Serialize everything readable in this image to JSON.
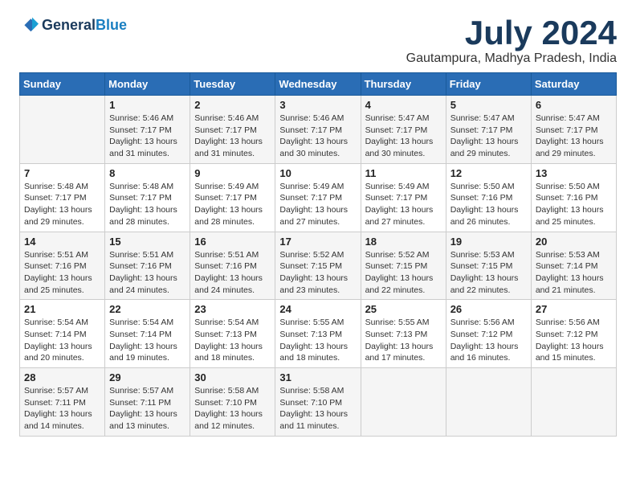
{
  "logo": {
    "line1": "General",
    "line2": "Blue"
  },
  "title": "July 2024",
  "location": "Gautampura, Madhya Pradesh, India",
  "weekdays": [
    "Sunday",
    "Monday",
    "Tuesday",
    "Wednesday",
    "Thursday",
    "Friday",
    "Saturday"
  ],
  "weeks": [
    [
      {
        "day": "",
        "info": ""
      },
      {
        "day": "1",
        "info": "Sunrise: 5:46 AM\nSunset: 7:17 PM\nDaylight: 13 hours\nand 31 minutes."
      },
      {
        "day": "2",
        "info": "Sunrise: 5:46 AM\nSunset: 7:17 PM\nDaylight: 13 hours\nand 31 minutes."
      },
      {
        "day": "3",
        "info": "Sunrise: 5:46 AM\nSunset: 7:17 PM\nDaylight: 13 hours\nand 30 minutes."
      },
      {
        "day": "4",
        "info": "Sunrise: 5:47 AM\nSunset: 7:17 PM\nDaylight: 13 hours\nand 30 minutes."
      },
      {
        "day": "5",
        "info": "Sunrise: 5:47 AM\nSunset: 7:17 PM\nDaylight: 13 hours\nand 29 minutes."
      },
      {
        "day": "6",
        "info": "Sunrise: 5:47 AM\nSunset: 7:17 PM\nDaylight: 13 hours\nand 29 minutes."
      }
    ],
    [
      {
        "day": "7",
        "info": "Sunrise: 5:48 AM\nSunset: 7:17 PM\nDaylight: 13 hours\nand 29 minutes."
      },
      {
        "day": "8",
        "info": "Sunrise: 5:48 AM\nSunset: 7:17 PM\nDaylight: 13 hours\nand 28 minutes."
      },
      {
        "day": "9",
        "info": "Sunrise: 5:49 AM\nSunset: 7:17 PM\nDaylight: 13 hours\nand 28 minutes."
      },
      {
        "day": "10",
        "info": "Sunrise: 5:49 AM\nSunset: 7:17 PM\nDaylight: 13 hours\nand 27 minutes."
      },
      {
        "day": "11",
        "info": "Sunrise: 5:49 AM\nSunset: 7:17 PM\nDaylight: 13 hours\nand 27 minutes."
      },
      {
        "day": "12",
        "info": "Sunrise: 5:50 AM\nSunset: 7:16 PM\nDaylight: 13 hours\nand 26 minutes."
      },
      {
        "day": "13",
        "info": "Sunrise: 5:50 AM\nSunset: 7:16 PM\nDaylight: 13 hours\nand 25 minutes."
      }
    ],
    [
      {
        "day": "14",
        "info": "Sunrise: 5:51 AM\nSunset: 7:16 PM\nDaylight: 13 hours\nand 25 minutes."
      },
      {
        "day": "15",
        "info": "Sunrise: 5:51 AM\nSunset: 7:16 PM\nDaylight: 13 hours\nand 24 minutes."
      },
      {
        "day": "16",
        "info": "Sunrise: 5:51 AM\nSunset: 7:16 PM\nDaylight: 13 hours\nand 24 minutes."
      },
      {
        "day": "17",
        "info": "Sunrise: 5:52 AM\nSunset: 7:15 PM\nDaylight: 13 hours\nand 23 minutes."
      },
      {
        "day": "18",
        "info": "Sunrise: 5:52 AM\nSunset: 7:15 PM\nDaylight: 13 hours\nand 22 minutes."
      },
      {
        "day": "19",
        "info": "Sunrise: 5:53 AM\nSunset: 7:15 PM\nDaylight: 13 hours\nand 22 minutes."
      },
      {
        "day": "20",
        "info": "Sunrise: 5:53 AM\nSunset: 7:14 PM\nDaylight: 13 hours\nand 21 minutes."
      }
    ],
    [
      {
        "day": "21",
        "info": "Sunrise: 5:54 AM\nSunset: 7:14 PM\nDaylight: 13 hours\nand 20 minutes."
      },
      {
        "day": "22",
        "info": "Sunrise: 5:54 AM\nSunset: 7:14 PM\nDaylight: 13 hours\nand 19 minutes."
      },
      {
        "day": "23",
        "info": "Sunrise: 5:54 AM\nSunset: 7:13 PM\nDaylight: 13 hours\nand 18 minutes."
      },
      {
        "day": "24",
        "info": "Sunrise: 5:55 AM\nSunset: 7:13 PM\nDaylight: 13 hours\nand 18 minutes."
      },
      {
        "day": "25",
        "info": "Sunrise: 5:55 AM\nSunset: 7:13 PM\nDaylight: 13 hours\nand 17 minutes."
      },
      {
        "day": "26",
        "info": "Sunrise: 5:56 AM\nSunset: 7:12 PM\nDaylight: 13 hours\nand 16 minutes."
      },
      {
        "day": "27",
        "info": "Sunrise: 5:56 AM\nSunset: 7:12 PM\nDaylight: 13 hours\nand 15 minutes."
      }
    ],
    [
      {
        "day": "28",
        "info": "Sunrise: 5:57 AM\nSunset: 7:11 PM\nDaylight: 13 hours\nand 14 minutes."
      },
      {
        "day": "29",
        "info": "Sunrise: 5:57 AM\nSunset: 7:11 PM\nDaylight: 13 hours\nand 13 minutes."
      },
      {
        "day": "30",
        "info": "Sunrise: 5:58 AM\nSunset: 7:10 PM\nDaylight: 13 hours\nand 12 minutes."
      },
      {
        "day": "31",
        "info": "Sunrise: 5:58 AM\nSunset: 7:10 PM\nDaylight: 13 hours\nand 11 minutes."
      },
      {
        "day": "",
        "info": ""
      },
      {
        "day": "",
        "info": ""
      },
      {
        "day": "",
        "info": ""
      }
    ]
  ]
}
